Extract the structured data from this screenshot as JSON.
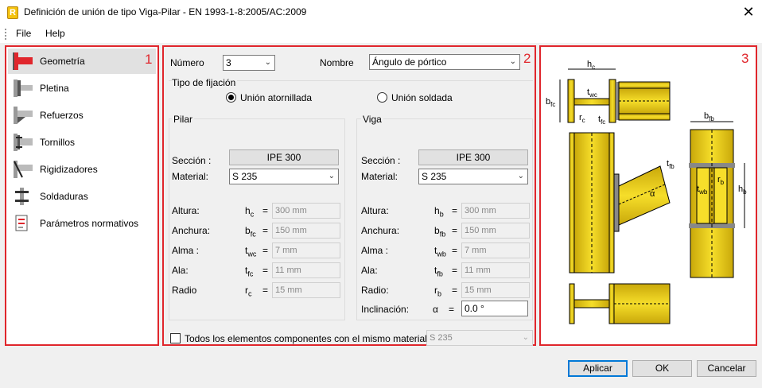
{
  "window": {
    "title": "Definición de unión de tipo Viga-Pilar - EN 1993-1-8:2005/AC:2009",
    "close_glyph": "✕"
  },
  "menu": [
    "File",
    "Help"
  ],
  "panel_numbers": [
    "1",
    "2",
    "3"
  ],
  "sidebar": {
    "items": [
      {
        "label": "Geometría",
        "icon": "geometry-icon",
        "selected": true
      },
      {
        "label": "Pletina",
        "icon": "plate-icon",
        "selected": false
      },
      {
        "label": "Refuerzos",
        "icon": "reinforcement-icon",
        "selected": false
      },
      {
        "label": "Tornillos",
        "icon": "bolts-icon",
        "selected": false
      },
      {
        "label": "Rigidizadores",
        "icon": "stiffeners-icon",
        "selected": false
      },
      {
        "label": "Soldaduras",
        "icon": "welds-icon",
        "selected": false
      },
      {
        "label": "Parámetros normativos",
        "icon": "code-parameters-icon",
        "selected": false
      }
    ]
  },
  "form": {
    "numero_label": "Número",
    "numero_value": "3",
    "nombre_label": "Nombre",
    "nombre_value": "Ángulo de pórtico",
    "fixation_label": "Tipo de fijación",
    "bolted_label": "Unión atornillada",
    "welded_label": "Unión soldada",
    "bolted_selected": true,
    "pilar": {
      "title": "Pilar",
      "section_label": "Sección :",
      "section_value": "IPE 300",
      "material_label": "Material:",
      "material_value": "S 235",
      "rows": [
        {
          "label": "Altura:",
          "sym": "h",
          "sub": "c",
          "value": "300 mm"
        },
        {
          "label": "Anchura:",
          "sym": "b",
          "sub": "fc",
          "value": "150 mm"
        },
        {
          "label": "Alma :",
          "sym": "t",
          "sub": "wc",
          "value": "7 mm"
        },
        {
          "label": "Ala:",
          "sym": "t",
          "sub": "fc",
          "value": "11 mm"
        },
        {
          "label": "Radio",
          "sym": "r",
          "sub": "c",
          "value": "15 mm"
        }
      ]
    },
    "viga": {
      "title": "Viga",
      "section_label": "Sección :",
      "section_value": "IPE 300",
      "material_label": "Material:",
      "material_value": "S 235",
      "rows": [
        {
          "label": "Altura:",
          "sym": "h",
          "sub": "b",
          "value": "300 mm"
        },
        {
          "label": "Anchura:",
          "sym": "b",
          "sub": "fb",
          "value": "150 mm"
        },
        {
          "label": "Alma :",
          "sym": "t",
          "sub": "wb",
          "value": "7 mm"
        },
        {
          "label": "Ala:",
          "sym": "t",
          "sub": "fb",
          "value": "11 mm"
        },
        {
          "label": "Radio:",
          "sym": "r",
          "sub": "b",
          "value": "15 mm"
        }
      ],
      "inclination_label": "Inclinación:",
      "inclination_sym": "α",
      "inclination_value": "0.0 °"
    },
    "same_material_label": "Todos los elementos componentes con el mismo material:",
    "same_material_value": "S 235",
    "same_material_checked": false
  },
  "drawing_labels": {
    "hc": "h",
    "hc_sub": "c",
    "bfc": "b",
    "bfc_sub": "fc",
    "twc": "t",
    "twc_sub": "wc",
    "rc": "r",
    "rc_sub": "c",
    "tfc": "t",
    "tfc_sub": "fc",
    "bfb": "b",
    "bfb_sub": "fb",
    "tfb": "t",
    "tfb_sub": "fb",
    "twb": "t",
    "twb_sub": "wb",
    "rb": "r",
    "rb_sub": "b",
    "hb": "h",
    "hb_sub": "b",
    "alpha": "α"
  },
  "buttons": {
    "apply": "Aplicar",
    "ok": "OK",
    "cancel": "Cancelar"
  },
  "colors": {
    "accent_red": "#e0262c",
    "steel_yellow": "#f2d21b",
    "steel_gray": "#8a8a8a"
  }
}
